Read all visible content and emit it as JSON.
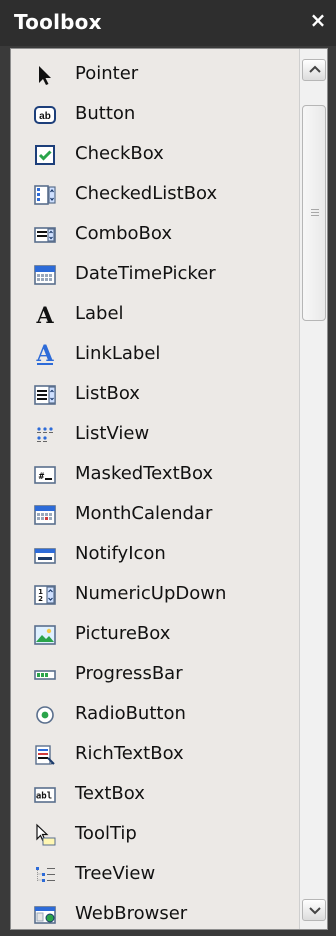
{
  "window": {
    "title": "Toolbox",
    "close_glyph": "×"
  },
  "items": [
    {
      "label": "Pointer",
      "icon": "pointer-icon"
    },
    {
      "label": "Button",
      "icon": "button-icon"
    },
    {
      "label": "CheckBox",
      "icon": "checkbox-icon"
    },
    {
      "label": "CheckedListBox",
      "icon": "checkedlistbox-icon"
    },
    {
      "label": "ComboBox",
      "icon": "combobox-icon"
    },
    {
      "label": "DateTimePicker",
      "icon": "datetimepicker-icon"
    },
    {
      "label": "Label",
      "icon": "label-icon"
    },
    {
      "label": "LinkLabel",
      "icon": "linklabel-icon"
    },
    {
      "label": "ListBox",
      "icon": "listbox-icon"
    },
    {
      "label": "ListView",
      "icon": "listview-icon"
    },
    {
      "label": "MaskedTextBox",
      "icon": "maskedtextbox-icon"
    },
    {
      "label": "MonthCalendar",
      "icon": "monthcalendar-icon"
    },
    {
      "label": "NotifyIcon",
      "icon": "notifyicon-icon"
    },
    {
      "label": "NumericUpDown",
      "icon": "numericupdown-icon"
    },
    {
      "label": "PictureBox",
      "icon": "picturebox-icon"
    },
    {
      "label": "ProgressBar",
      "icon": "progressbar-icon"
    },
    {
      "label": "RadioButton",
      "icon": "radiobutton-icon"
    },
    {
      "label": "RichTextBox",
      "icon": "richtextbox-icon"
    },
    {
      "label": "TextBox",
      "icon": "textbox-icon"
    },
    {
      "label": "ToolTip",
      "icon": "tooltip-icon"
    },
    {
      "label": "TreeView",
      "icon": "treeview-icon"
    },
    {
      "label": "WebBrowser",
      "icon": "webbrowser-icon"
    }
  ],
  "colors": {
    "title_bar": "#2e2e2e",
    "panel_bg": "#ece9e6",
    "scrollbar": "#f1f1f1"
  }
}
